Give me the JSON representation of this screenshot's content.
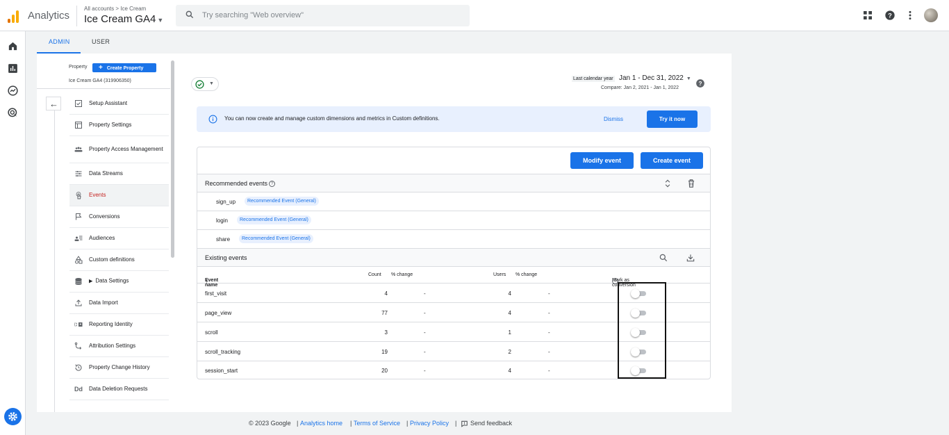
{
  "header": {
    "app_name": "Analytics",
    "breadcrumb_all": "All accounts",
    "breadcrumb_sep": ">",
    "breadcrumb_account": "Ice Cream",
    "property_title": "Ice Cream GA4",
    "search_placeholder": "Try searching \"Web overview\"",
    "icons": [
      "apps-grid-icon",
      "help-icon",
      "more-vert-icon",
      "avatar"
    ]
  },
  "tabs": [
    {
      "label": "ADMIN",
      "active": true
    },
    {
      "label": "USER",
      "active": false
    }
  ],
  "sidebar": {
    "property_label": "Property",
    "create_button": "Create Property",
    "property_id": "Ice Cream GA4 (319906350)",
    "items": [
      {
        "label": "Setup Assistant",
        "icon": "checklist-icon"
      },
      {
        "label": "Property Settings",
        "icon": "settings-square-icon"
      },
      {
        "label": "Property Access Management",
        "icon": "people-icon"
      },
      {
        "label": "Data Streams",
        "icon": "streams-icon"
      },
      {
        "label": "Events",
        "icon": "touch-icon",
        "active": true
      },
      {
        "label": "Conversions",
        "icon": "flag-icon"
      },
      {
        "label": "Audiences",
        "icon": "audience-icon"
      },
      {
        "label": "Custom definitions",
        "icon": "shapes-icon"
      },
      {
        "label": "Data Settings",
        "icon": "database-icon"
      },
      {
        "label": "Data Import",
        "icon": "upload-icon"
      },
      {
        "label": "Reporting Identity",
        "icon": "identity-icon"
      },
      {
        "label": "Attribution Settings",
        "icon": "attribution-icon"
      },
      {
        "label": "Property Change History",
        "icon": "history-icon"
      },
      {
        "label": "Data Deletion Requests",
        "icon": "dd-icon"
      }
    ]
  },
  "date_range": {
    "label": "Last calendar year",
    "value": "Jan 1 - Dec 31, 2022",
    "compare": "Compare: Jan 2, 2021 - Jan 1, 2022"
  },
  "banner": {
    "text": "You can now create and manage custom dimensions and metrics in Custom definitions.",
    "dismiss": "Dismiss",
    "try": "Try it now"
  },
  "events": {
    "modify_button": "Modify event",
    "create_button": "Create event",
    "recommended_title": "Recommended events",
    "recommended": [
      {
        "name": "sign_up",
        "tag": "Recommended Event (General)"
      },
      {
        "name": "login",
        "tag": "Recommended Event (General)"
      },
      {
        "name": "share",
        "tag": "Recommended Event (General)"
      }
    ],
    "existing_title": "Existing events",
    "columns": {
      "event_name": "Event name",
      "count": "Count",
      "count_change": "% change",
      "users": "Users",
      "users_change": "% change",
      "mark": "Mark as conversion"
    },
    "rows": [
      {
        "name": "first_visit",
        "count": "4",
        "count_change": "-",
        "users": "4",
        "users_change": "-",
        "conversion": false
      },
      {
        "name": "page_view",
        "count": "77",
        "count_change": "-",
        "users": "4",
        "users_change": "-",
        "conversion": false
      },
      {
        "name": "scroll",
        "count": "3",
        "count_change": "-",
        "users": "1",
        "users_change": "-",
        "conversion": false
      },
      {
        "name": "scroll_tracking",
        "count": "19",
        "count_change": "-",
        "users": "2",
        "users_change": "-",
        "conversion": false
      },
      {
        "name": "session_start",
        "count": "20",
        "count_change": "-",
        "users": "4",
        "users_change": "-",
        "conversion": false
      }
    ]
  },
  "footer": {
    "copyright": "© 2023 Google",
    "sep": "|",
    "analytics_home": "Analytics home",
    "terms": "Terms of Service",
    "privacy": "Privacy Policy",
    "feedback": "Send feedback"
  },
  "colors": {
    "accent": "#1a73e8",
    "active_item": "#c5221f",
    "logo_orange": "#f9ab00",
    "logo_dark_orange": "#e37400"
  }
}
